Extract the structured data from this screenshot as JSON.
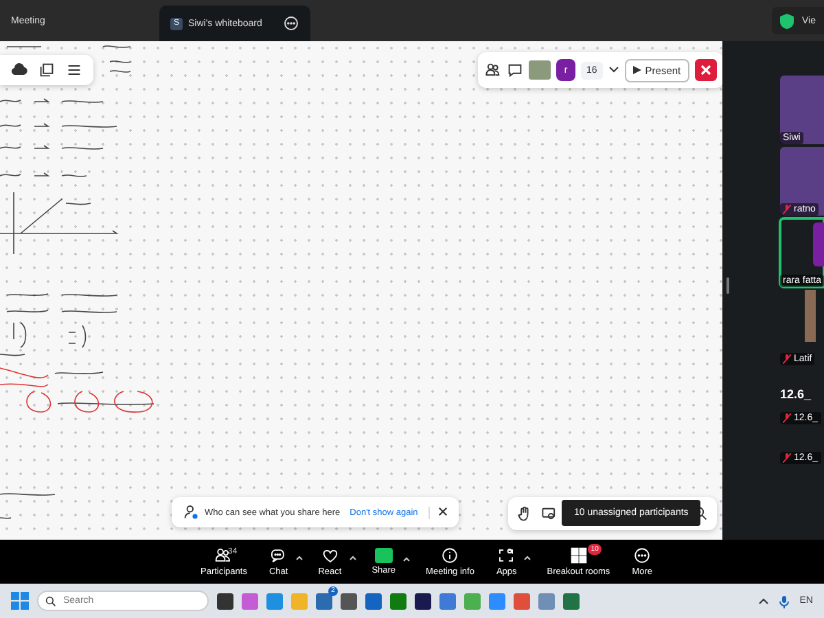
{
  "tabs": [
    {
      "label": "Meeting",
      "selected": false
    },
    {
      "label": "Siwi's whiteboard",
      "badge": "S",
      "selected": true
    }
  ],
  "view_label": "Vie",
  "board_toolbar": {
    "avatar": "r",
    "count": "16",
    "present": "Present"
  },
  "notice": {
    "text": "Who can see what you share here",
    "link": "Don't show again"
  },
  "tooltip": "10 unassigned participants",
  "participants": [
    {
      "kind": "video",
      "name": "Siwi",
      "muted": false,
      "speaking": false
    },
    {
      "kind": "video",
      "name": "ratno",
      "muted": true,
      "speaking": false
    },
    {
      "kind": "avatar",
      "name": "rara fatta",
      "muted": false,
      "speaking": true
    },
    {
      "kind": "photo",
      "name": "Latif",
      "muted": true,
      "speaking": false
    },
    {
      "kind": "heading",
      "name": "12.6_",
      "muted": false,
      "speaking": false
    },
    {
      "kind": "label",
      "name": "12.6_",
      "muted": true,
      "speaking": false
    },
    {
      "kind": "label",
      "name": "12.6_",
      "muted": true,
      "speaking": false
    }
  ],
  "toolbar": [
    {
      "kind": "people",
      "label": "Participants",
      "count": "34",
      "caret": false
    },
    {
      "kind": "chat",
      "label": "Chat",
      "caret": true
    },
    {
      "kind": "heart",
      "label": "React",
      "caret": true
    },
    {
      "kind": "share",
      "label": "Share",
      "caret": true
    },
    {
      "kind": "info",
      "label": "Meeting info",
      "caret": false
    },
    {
      "kind": "apps",
      "label": "Apps",
      "caret": true
    },
    {
      "kind": "grid",
      "label": "Breakout rooms",
      "badge": "10",
      "caret": false
    },
    {
      "kind": "more",
      "label": "More",
      "caret": false
    }
  ],
  "taskbar": {
    "search_placeholder": "Search",
    "store_badge": "2",
    "language": "EN"
  }
}
